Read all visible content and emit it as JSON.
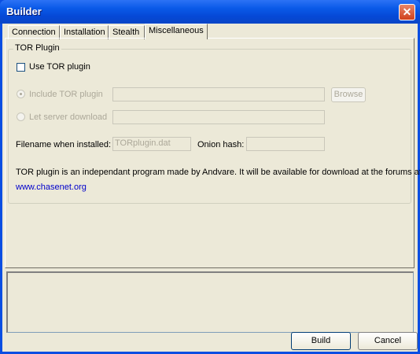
{
  "window": {
    "title": "Builder",
    "close_label": "✕"
  },
  "tabs": [
    "Connection",
    "Installation",
    "Stealth",
    "Miscellaneous"
  ],
  "active_tab": "Miscellaneous",
  "group": {
    "label": "TOR Plugin"
  },
  "use_tor": {
    "label": "Use TOR plugin",
    "checked": false
  },
  "include_tor": {
    "label": "Include TOR plugin",
    "value": ""
  },
  "browse_label": "Browse",
  "server_download": {
    "label": "Let server download",
    "value": ""
  },
  "filename": {
    "label": "Filename when installed:",
    "value": "TORplugin.dat"
  },
  "onion": {
    "label": "Onion hash:",
    "value": ""
  },
  "info_text": "TOR plugin is an independant program made by Andvare. It will be available for download at the forums at",
  "link_text": "www.chasenet.org",
  "buttons": {
    "build": "Build",
    "cancel": "Cancel"
  },
  "colors": {
    "titlebar": "#0a5ae8",
    "face": "#ece9d8",
    "close": "#d0401c",
    "link": "#0000cc"
  }
}
